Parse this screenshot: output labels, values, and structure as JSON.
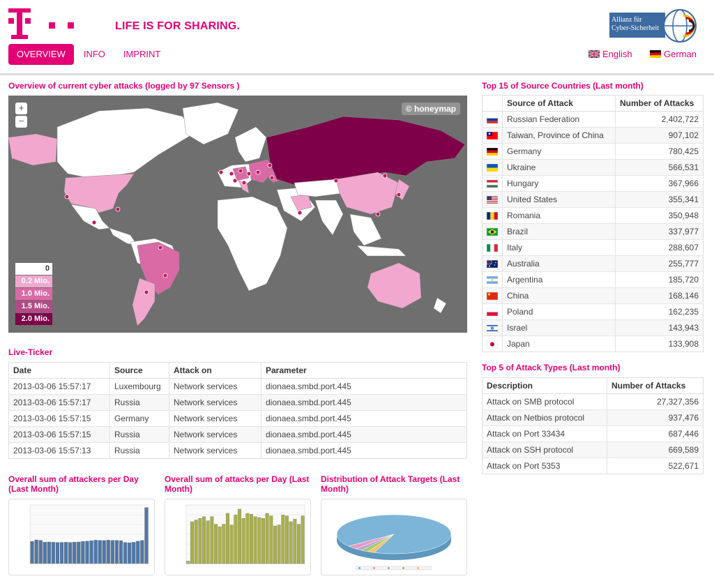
{
  "header": {
    "slogan": "LIFE IS FOR SHARING.",
    "alliance_line1": "Allianz für",
    "alliance_line2": "Cyber-Sicherheit",
    "nav": [
      "OVERVIEW",
      "INFO",
      "IMPRINT"
    ],
    "lang_english": "English",
    "lang_german": "German"
  },
  "map": {
    "title": "Overview of current cyber attacks (logged by 97 Sensors )",
    "zoom_in": "+",
    "zoom_out": "−",
    "credit": "© honeymap",
    "legend": [
      "0",
      "0.2 Mio.",
      "1.0 Mio.",
      "1.5 Mio.",
      "2.0 Mio."
    ],
    "colors": {
      "ocean": "#6f6f6f",
      "none": "#ffffff",
      "l1": "#f2a7cf",
      "l2": "#d96aa6",
      "l3": "#b34a86",
      "l4": "#7d0048"
    }
  },
  "live_ticker": {
    "title": "Live-Ticker",
    "headers": [
      "Date",
      "Source",
      "Attack on",
      "Parameter"
    ],
    "rows": [
      [
        "2013-03-06 15:57:17",
        "Luxembourg",
        "Network services",
        "dionaea.smbd.port.445"
      ],
      [
        "2013-03-06 15:57:17",
        "Russia",
        "Network services",
        "dionaea.smbd.port.445"
      ],
      [
        "2013-03-06 15:57:15",
        "Germany",
        "Network services",
        "dionaea.smbd.port.445"
      ],
      [
        "2013-03-06 15:57:15",
        "Russia",
        "Network services",
        "dionaea.smbd.port.445"
      ],
      [
        "2013-03-06 15:57:13",
        "Russia",
        "Network services",
        "dionaea.smbd.port.445"
      ]
    ]
  },
  "top_countries": {
    "title": "Top 15 of Source Countries (Last month)",
    "headers": [
      "Source of Attack",
      "Number of Attacks"
    ],
    "rows": [
      {
        "flag": "ru",
        "name": "Russian Federation",
        "count": "2,402,722"
      },
      {
        "flag": "tw",
        "name": "Taiwan, Province of China",
        "count": "907,102"
      },
      {
        "flag": "de",
        "name": "Germany",
        "count": "780,425"
      },
      {
        "flag": "ua",
        "name": "Ukraine",
        "count": "566,531"
      },
      {
        "flag": "hu",
        "name": "Hungary",
        "count": "367,966"
      },
      {
        "flag": "us",
        "name": "United States",
        "count": "355,341"
      },
      {
        "flag": "ro",
        "name": "Romania",
        "count": "350,948"
      },
      {
        "flag": "br",
        "name": "Brazil",
        "count": "337,977"
      },
      {
        "flag": "it",
        "name": "Italy",
        "count": "288,607"
      },
      {
        "flag": "au",
        "name": "Australia",
        "count": "255,777"
      },
      {
        "flag": "ar",
        "name": "Argentina",
        "count": "185,720"
      },
      {
        "flag": "cn",
        "name": "China",
        "count": "168,146"
      },
      {
        "flag": "pl",
        "name": "Poland",
        "count": "162,235"
      },
      {
        "flag": "il",
        "name": "Israel",
        "count": "143,943"
      },
      {
        "flag": "jp",
        "name": "Japan",
        "count": "133,908"
      }
    ]
  },
  "top_attacks": {
    "title": "Top 5 of Attack Types (Last month)",
    "headers": [
      "Description",
      "Number of Attacks"
    ],
    "rows": [
      [
        "Attack on SMB protocol",
        "27,327,356"
      ],
      [
        "Attack on Netbios protocol",
        "937,476"
      ],
      [
        "Attack on Port 33434",
        "687,446"
      ],
      [
        "Attack on SSH protocol",
        "669,589"
      ],
      [
        "Attack on Port 5353",
        "522,671"
      ]
    ]
  },
  "charts": {
    "attackers_title": "Overall sum of attackers per Day (Last Month)",
    "attacks_title": "Overall sum of attacks per Day (Last Month)",
    "targets_title": "Distribution of Attack Targets (Last Month)"
  },
  "chart_data": [
    {
      "type": "bar",
      "title": "Overall sum of attackers per Day (Last Month)",
      "color": "#4f78a8",
      "values": [
        1700,
        1820,
        1780,
        1650,
        1660,
        1640,
        1620,
        1630,
        1640,
        1620,
        1650,
        1660,
        1700,
        1720,
        1760,
        1800,
        1780,
        1770,
        1800,
        1780,
        1780,
        1760,
        1620,
        1600,
        1640,
        1720,
        1780,
        4300
      ],
      "ylim": [
        0,
        4500
      ]
    },
    {
      "type": "bar",
      "title": "Overall sum of attacks per Day (Last Month)",
      "color": "#a9b14a",
      "values": [
        30000,
        500000,
        520000,
        540000,
        560000,
        510000,
        560000,
        470000,
        440000,
        470000,
        600000,
        460000,
        580000,
        650000,
        540000,
        600000,
        590000,
        560000,
        550000,
        540000,
        600000,
        570000,
        450000,
        460000,
        580000,
        570000,
        500000,
        530000,
        470000,
        570000
      ],
      "ylim": [
        0,
        700000
      ]
    },
    {
      "type": "pie",
      "title": "Distribution of Attack Targets (Last Month)",
      "values": [
        91,
        3,
        2,
        2,
        2
      ],
      "colors": [
        "#7cb5d8",
        "#e899c4",
        "#b8a6d6",
        "#a3c96a",
        "#f2c36b"
      ]
    }
  ]
}
